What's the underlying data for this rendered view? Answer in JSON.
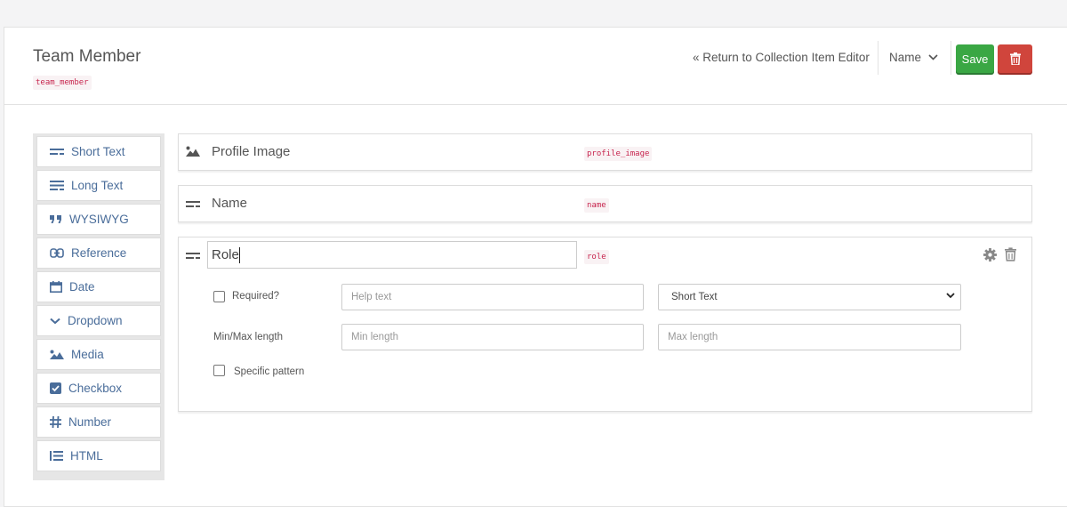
{
  "header": {
    "title": "Team Member",
    "slug": "team_member",
    "return_link": "« Return to Collection Item Editor",
    "sort_label": "Name",
    "save_label": "Save"
  },
  "palette": {
    "items": [
      {
        "label": "Short Text",
        "icon": "short-text-icon"
      },
      {
        "label": "Long Text",
        "icon": "long-text-icon"
      },
      {
        "label": "WYSIWYG",
        "icon": "quote-icon"
      },
      {
        "label": "Reference",
        "icon": "link-icon"
      },
      {
        "label": "Date",
        "icon": "calendar-icon"
      },
      {
        "label": "Dropdown",
        "icon": "chevron-down-icon"
      },
      {
        "label": "Media",
        "icon": "image-icon"
      },
      {
        "label": "Checkbox",
        "icon": "checkbox-icon"
      },
      {
        "label": "Number",
        "icon": "hash-icon"
      },
      {
        "label": "HTML",
        "icon": "list-icon"
      }
    ]
  },
  "fields": {
    "profile_image": {
      "label": "Profile Image",
      "key": "profile_image",
      "icon": "image-icon"
    },
    "name": {
      "label": "Name",
      "key": "name",
      "icon": "short-text-icon"
    },
    "role": {
      "value": "Role",
      "key": "role",
      "icon": "short-text-icon",
      "required_label": "Required?",
      "help_placeholder": "Help text",
      "type_value": "Short Text",
      "minmax_label": "Min/Max length",
      "min_placeholder": "Min length",
      "max_placeholder": "Max length",
      "pattern_label": "Specific pattern"
    }
  },
  "colors": {
    "save": "#3aa744",
    "delete": "#d0453c",
    "palette_text": "#4a6d9a",
    "key_text": "#c7254e"
  }
}
